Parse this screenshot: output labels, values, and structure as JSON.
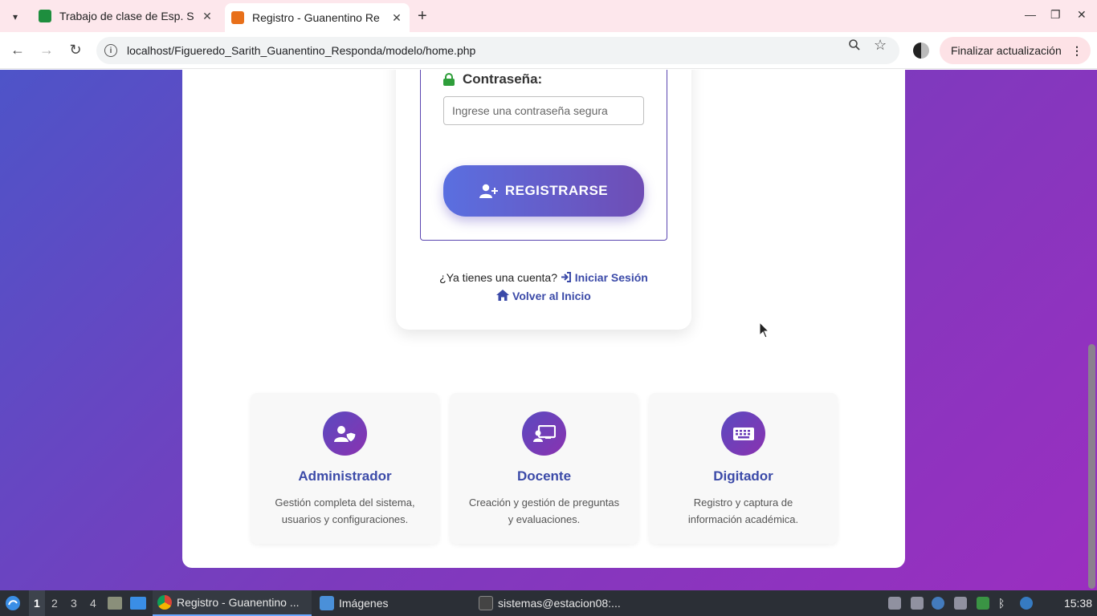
{
  "browser": {
    "tabs": [
      {
        "title": "Trabajo de clase de Esp. S",
        "active": false,
        "favicon_color": "#1e8e3e"
      },
      {
        "title": "Registro - Guanentino Re",
        "active": true,
        "favicon_color": "#e8701a"
      }
    ],
    "url": "localhost/Figueredo_Sarith_Guanentino_Responda/modelo/home.php",
    "update_button": "Finalizar actualización"
  },
  "form": {
    "password_label": "Contraseña:",
    "password_placeholder": "Ingrese una contraseña segura",
    "register_button": "REGISTRARSE",
    "have_account_text": "¿Ya tienes una cuenta?",
    "login_link": "Iniciar Sesión",
    "home_link": "Volver al Inicio"
  },
  "roles": [
    {
      "title": "Administrador",
      "description": "Gestión completa del sistema, usuarios y configuraciones.",
      "icon": "user-shield-icon"
    },
    {
      "title": "Docente",
      "description": "Creación y gestión de preguntas y evaluaciones.",
      "icon": "chalkboard-teacher-icon"
    },
    {
      "title": "Digitador",
      "description": "Registro y captura de información académica.",
      "icon": "keyboard-icon"
    }
  ],
  "taskbar": {
    "workspaces": [
      "1",
      "2",
      "3",
      "4"
    ],
    "apps": [
      {
        "label": "Registro - Guanentino ...",
        "active": true
      },
      {
        "label": "Imágenes",
        "active": false
      },
      {
        "label": "sistemas@estacion08:...",
        "active": false
      }
    ],
    "clock": "15:38"
  },
  "colors": {
    "gradient_start": "#4e54c8",
    "gradient_end": "#9b2ec0",
    "accent": "#3b4aa8",
    "lock_green": "#2e9e3a"
  }
}
